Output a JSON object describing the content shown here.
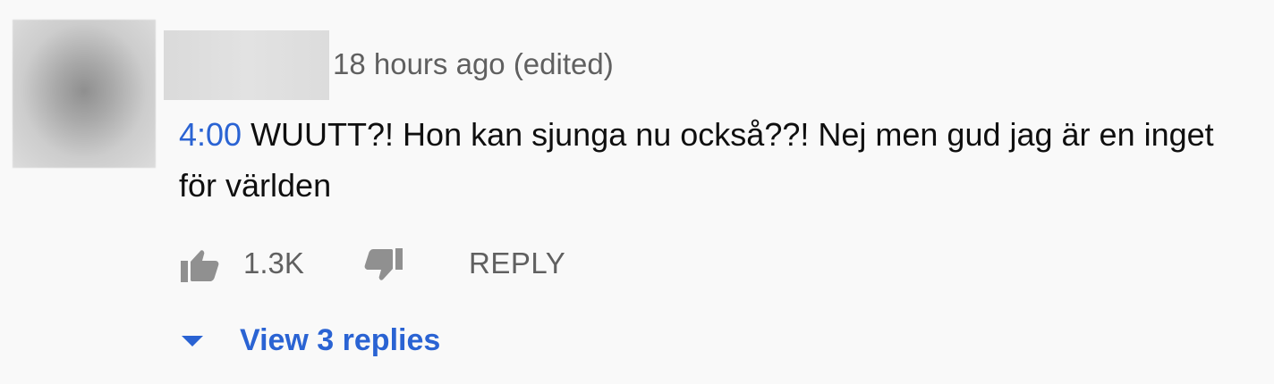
{
  "comment": {
    "author_avatar": "avatar (blurred)",
    "author_name_hidden": true,
    "timestamp": "18 hours ago (edited)",
    "timestamp_link": "4:00",
    "text": " WUUTT?! Hon kan sjunga nu också??! Nej men gud jag är en inget för världen",
    "like_count": "1.3K",
    "reply_label": "REPLY",
    "view_replies_label": "View 3 replies",
    "icons": {
      "like": "thumbs-up-icon",
      "dislike": "thumbs-down-icon",
      "expand": "caret-down-icon"
    },
    "colors": {
      "link": "#2a63d3",
      "secondary_text": "#606060",
      "icon": "#909090",
      "background": "#f9f9f9"
    }
  }
}
